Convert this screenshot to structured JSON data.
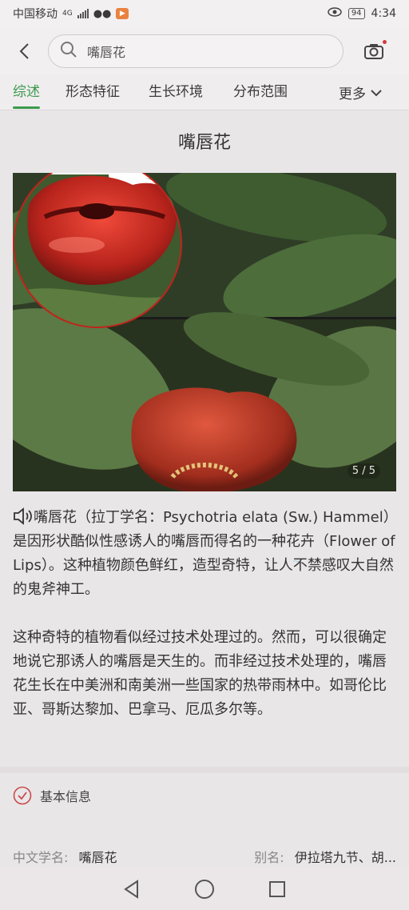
{
  "status_bar": {
    "carrier": "中国移动",
    "network": "4G",
    "battery": "94",
    "time": "4:34"
  },
  "search": {
    "query": "嘴唇花",
    "back_icon": "chevron-left-icon",
    "search_icon": "search-icon",
    "camera_icon": "camera-icon"
  },
  "tabs": {
    "items": [
      {
        "label": "综述",
        "active": true
      },
      {
        "label": "形态特征",
        "active": false
      },
      {
        "label": "生长环境",
        "active": false
      },
      {
        "label": "分布范围",
        "active": false
      }
    ],
    "more_label": "更多"
  },
  "content": {
    "title": "嘴唇花",
    "image_counter": "5 / 5",
    "paragraph1": "嘴唇花（拉丁学名：Psychotria elata (Sw.) Hammel）是因形状酷似性感诱人的嘴唇而得名的一种花卉（Flower of Lips）。这种植物颜色鲜红，造型奇特，让人不禁感叹大自然的鬼斧神工。",
    "paragraph2": "这种奇特的植物看似经过技术处理过的。然而，可以很确定地说它那诱人的嘴唇是天生的。而非经过技术处理的，嘴唇花生长在中美洲和南美洲一些国家的热带雨林中。如哥伦比亚、哥斯达黎加、巴拿马、厄瓜多尔等。"
  },
  "basic_info": {
    "heading": "基本信息",
    "chinese_name_label": "中文学名:",
    "chinese_name_value": "嘴唇花",
    "alias_label": "别名:",
    "alias_value": "伊拉塔九节、胡..."
  },
  "colors": {
    "accent_green": "#3c9a4c",
    "check_red": "#c94a4a",
    "lip_red": "#c8201c"
  }
}
